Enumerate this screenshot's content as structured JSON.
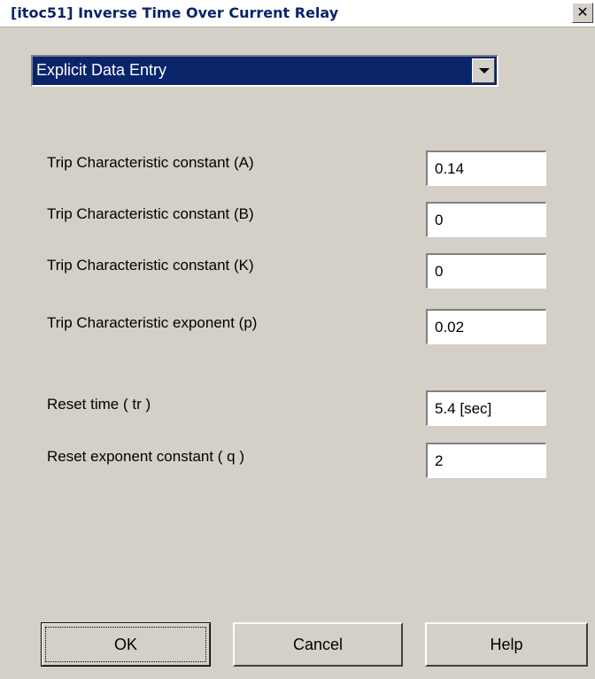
{
  "window": {
    "title": "[itoc51] Inverse Time Over Current Relay",
    "close_glyph": "✕"
  },
  "mode_select": {
    "value": "Explicit Data Entry"
  },
  "fields": {
    "const_a": {
      "label": "Trip Characteristic constant (A)",
      "value": "0.14"
    },
    "const_b": {
      "label": "Trip Characteristic constant (B)",
      "value": "0"
    },
    "const_k": {
      "label": "Trip Characteristic constant (K)",
      "value": "0"
    },
    "exponent_p": {
      "label": "Trip Characteristic exponent (p)",
      "value": "0.02"
    },
    "reset_time": {
      "label": "Reset time ( tr )",
      "value": "5.4 [sec]"
    },
    "reset_exponent": {
      "label": "Reset exponent constant ( q )",
      "value": "2"
    }
  },
  "buttons": {
    "ok": "OK",
    "cancel": "Cancel",
    "help": "Help"
  }
}
